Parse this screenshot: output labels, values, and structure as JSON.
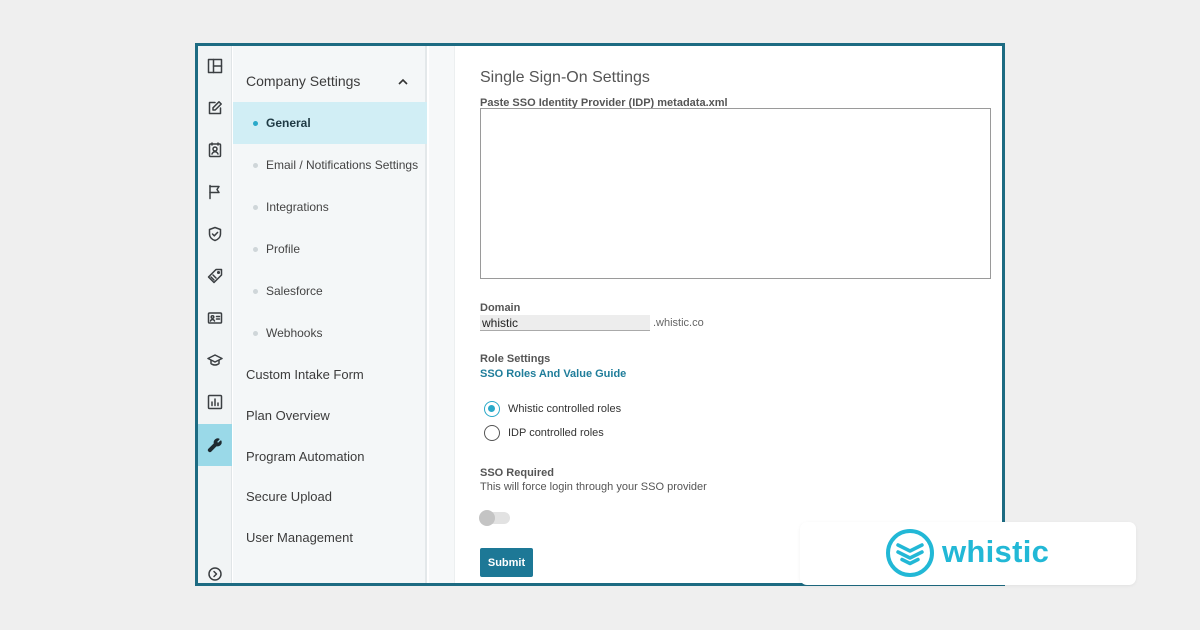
{
  "colors": {
    "accent": "#2aa9c9",
    "primary_button": "#1d7896",
    "link": "#1f7d9a",
    "window_border": "#1d6b82",
    "active_nav_bg": "#d1eef5",
    "brand": "#22b8d6"
  },
  "rail": {
    "icons": [
      "layout-icon",
      "edit-icon",
      "contact-icon",
      "flag-icon",
      "shield-check-icon",
      "tag-icon",
      "id-card-icon",
      "graduation-cap-icon",
      "bar-chart-icon",
      "wrench-icon",
      "expand-icon"
    ],
    "active": "wrench-icon"
  },
  "sidebar": {
    "section_title": "Company Settings",
    "sub_items": [
      {
        "label": "General",
        "active": true
      },
      {
        "label": "Email / Notifications Settings"
      },
      {
        "label": "Integrations"
      },
      {
        "label": "Profile"
      },
      {
        "label": "Salesforce"
      },
      {
        "label": "Webhooks"
      }
    ],
    "top_items": [
      "Custom Intake Form",
      "Plan Overview",
      "Program Automation",
      "Secure Upload",
      "User Management"
    ]
  },
  "main": {
    "title": "Single Sign-On Settings",
    "metadata_label": "Paste SSO Identity Provider (IDP) metadata.xml",
    "metadata_value": "",
    "domain_label": "Domain",
    "domain_value": "whistic",
    "domain_suffix": ".whistic.co",
    "role_settings_label": "Role Settings",
    "role_guide_link": "SSO Roles And Value Guide",
    "role_options": [
      {
        "label": "Whistic controlled roles",
        "selected": true
      },
      {
        "label": "IDP controlled roles",
        "selected": false
      }
    ],
    "sso_required_label": "SSO Required",
    "sso_required_help": "This will force login through your SSO provider",
    "sso_required_enabled": false,
    "submit_label": "Submit"
  },
  "brand": {
    "wordmark": "whistic"
  }
}
